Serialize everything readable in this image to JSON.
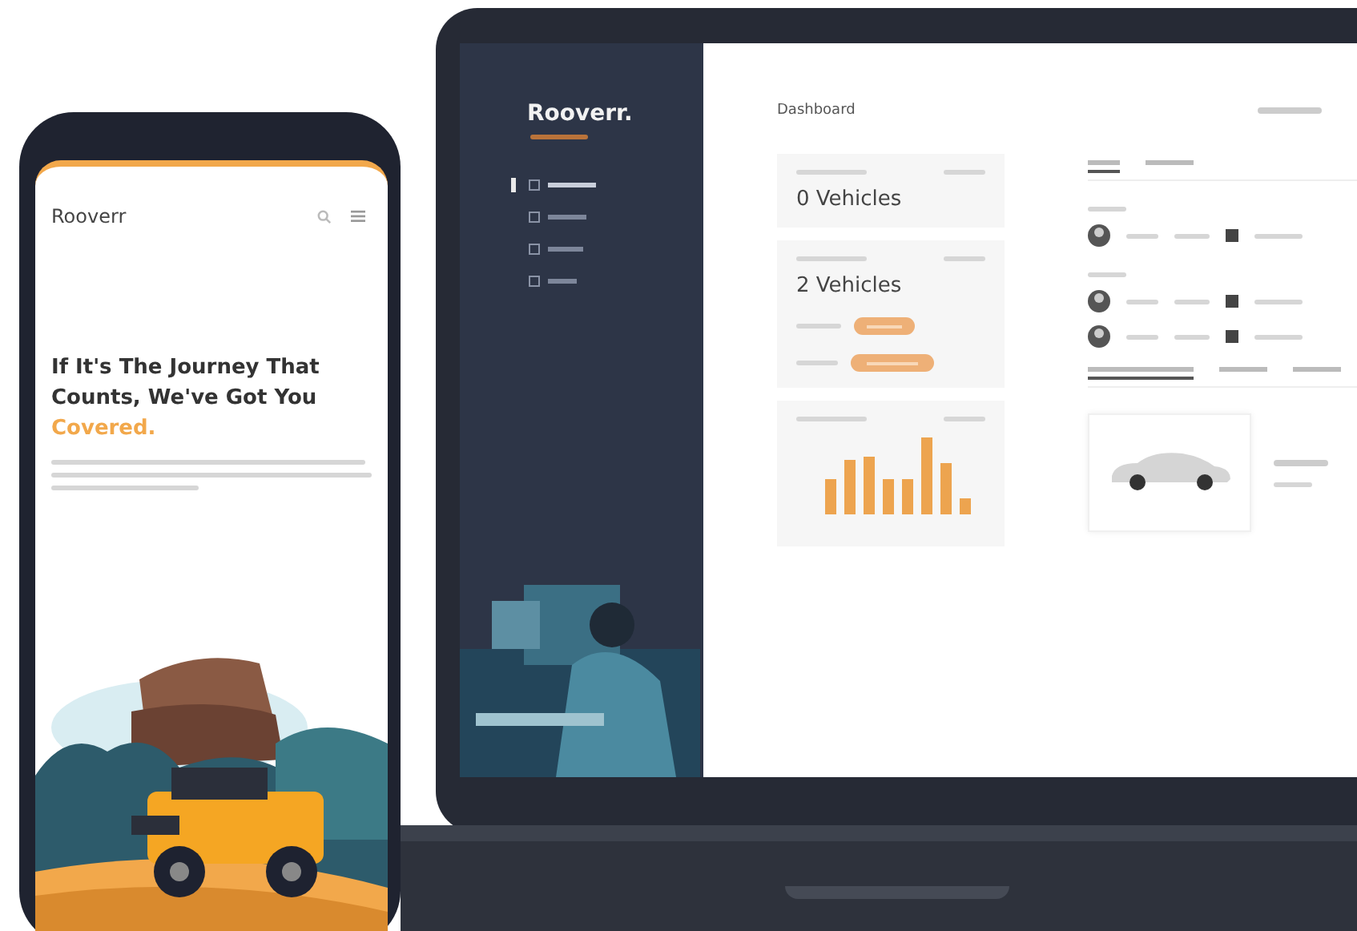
{
  "phone": {
    "logo": "Rooverr",
    "headline": {
      "text": "If It's The Journey That Counts, We've Got You",
      "highlight": "Covered."
    }
  },
  "laptop": {
    "sidebar": {
      "logo": "Rooverr.",
      "items": [
        {
          "selected": true
        },
        {
          "selected": false
        },
        {
          "selected": false
        },
        {
          "selected": false
        }
      ]
    },
    "page_title": "Dashboard",
    "cards": [
      {
        "kind": "plain",
        "value": "0 Vehicles"
      },
      {
        "kind": "pills",
        "value": "2 Vehicles"
      },
      {
        "kind": "chart"
      }
    ],
    "tabs": [
      {
        "selected": true
      },
      {
        "selected": false
      }
    ],
    "tabs_2": [
      {
        "selected": true
      },
      {
        "selected": false
      },
      {
        "selected": false
      }
    ]
  }
}
